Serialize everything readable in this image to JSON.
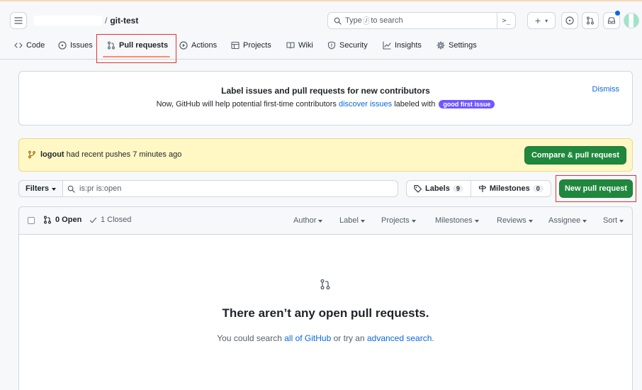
{
  "header": {
    "owner": "",
    "separator": "/",
    "repo": "git-test",
    "search": {
      "pre": "Type",
      "key": "/",
      "post": "to search",
      "command_glyph": ">_"
    },
    "plus_label": "+",
    "plus_caret": "▾"
  },
  "tabs": [
    {
      "label": "Code",
      "icon": "code-icon"
    },
    {
      "label": "Issues",
      "icon": "issue-opened-icon"
    },
    {
      "label": "Pull requests",
      "icon": "git-pull-request-icon",
      "selected": true
    },
    {
      "label": "Actions",
      "icon": "play-icon"
    },
    {
      "label": "Projects",
      "icon": "table-icon"
    },
    {
      "label": "Wiki",
      "icon": "book-icon"
    },
    {
      "label": "Security",
      "icon": "shield-icon"
    },
    {
      "label": "Insights",
      "icon": "graph-icon"
    },
    {
      "label": "Settings",
      "icon": "gear-icon"
    }
  ],
  "banner": {
    "title": "Label issues and pull requests for new contributors",
    "text_before": "Now, GitHub will help potential first-time contributors ",
    "link": "discover issues",
    "text_after": " labeled with ",
    "badge": "good first issue",
    "dismiss": "Dismiss"
  },
  "push": {
    "branch": "logout",
    "text": " had recent pushes 7 minutes ago",
    "button": "Compare & pull request"
  },
  "filters": {
    "button": "Filters",
    "query": "is:pr is:open",
    "labels": {
      "label": "Labels",
      "count": "9"
    },
    "milestones": {
      "label": "Milestones",
      "count": "0"
    },
    "new_pr": "New pull request"
  },
  "list": {
    "open": "0 Open",
    "closed": "1 Closed",
    "sort_items": [
      "Author",
      "Label",
      "Projects",
      "Milestones",
      "Reviews",
      "Assignee",
      "Sort"
    ]
  },
  "blankslate": {
    "title": "There aren’t any open pull requests.",
    "text_before": "You could search ",
    "link1": "all of GitHub",
    "text_mid": " or try an ",
    "link2": "advanced search",
    "text_after": "."
  },
  "colors": {
    "accent": "#0969da",
    "primary_button": "#1f883d",
    "badge_good_first_issue": "#7057ff",
    "highlight_box": "#e5322d",
    "selected_tab_underline": "#fd8c73",
    "push_banner": "#fff8c5"
  }
}
